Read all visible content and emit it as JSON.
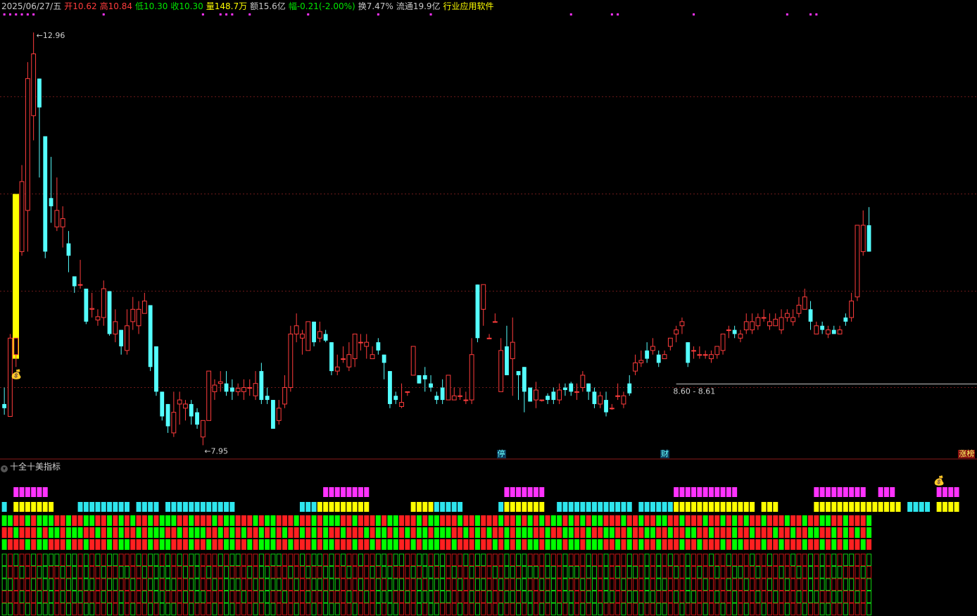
{
  "info": {
    "date": "2025/06/27/五",
    "open_label": "开",
    "open": "10.62",
    "high_label": "高",
    "high": "10.84",
    "low_label": "低",
    "low": "10.30",
    "close_label": "收",
    "close": "10.30",
    "volume": "量148.7万",
    "amount": "额15.6亿",
    "change": "幅-0.21(-2.00%)",
    "turnover": "换7.47%",
    "float_cap": "流通19.9亿",
    "industry": "行业应用软件"
  },
  "colors": {
    "up": "#ff3c3c",
    "down": "#54ffff",
    "grid": "#6e1a1a",
    "magenta": "#ff32ff",
    "yellow": "#ffff00",
    "green": "#00ff00",
    "red": "#ff2020",
    "cyan": "#2ee6ee"
  },
  "chart_data": {
    "type": "candlestick",
    "ylim": [
      7.8,
      13.2
    ],
    "high_label": "12.96",
    "low_label": "7.95",
    "range_label": "8.60 - 8.61",
    "range_level": 8.6,
    "grid_levels": [
      8.65,
      9.82,
      11.0,
      12.18
    ],
    "candles": [
      [
        8.45,
        8.4,
        8.65,
        8.32
      ],
      [
        8.3,
        9.25,
        9.3,
        8.3
      ],
      [
        9.05,
        9.25,
        9.25,
        8.9
      ],
      [
        10.3,
        11.15,
        11.35,
        10.25
      ],
      [
        10.8,
        12.4,
        12.6,
        10.3
      ],
      [
        11.95,
        12.7,
        12.96,
        11.65
      ],
      [
        12.4,
        12.05,
        12.4,
        11.2
      ],
      [
        11.7,
        10.3,
        11.7,
        10.22
      ],
      [
        10.95,
        10.85,
        11.45,
        10.65
      ],
      [
        10.6,
        10.8,
        11.2,
        10.55
      ],
      [
        10.6,
        10.7,
        10.85,
        10.35
      ],
      [
        10.4,
        10.25,
        10.55,
        10.05
      ],
      [
        10.0,
        9.88,
        10.0,
        9.8
      ],
      [
        9.9,
        9.9,
        10.2,
        9.85
      ],
      [
        9.85,
        9.45,
        9.85,
        9.42
      ],
      [
        9.6,
        9.61,
        9.8,
        9.5
      ],
      [
        9.47,
        9.51,
        9.6,
        9.4
      ],
      [
        9.5,
        9.85,
        9.95,
        9.4
      ],
      [
        9.82,
        9.3,
        9.82,
        9.28
      ],
      [
        9.3,
        9.45,
        9.6,
        9.2
      ],
      [
        9.35,
        9.15,
        9.35,
        9.05
      ],
      [
        9.1,
        9.4,
        9.6,
        9.05
      ],
      [
        9.45,
        9.6,
        9.75,
        9.35
      ],
      [
        9.4,
        9.6,
        9.7,
        9.3
      ],
      [
        9.55,
        9.7,
        9.8,
        9.55
      ],
      [
        9.65,
        8.9,
        9.65,
        8.85
      ],
      [
        9.15,
        8.6,
        9.15,
        8.55
      ],
      [
        8.6,
        8.3,
        8.6,
        8.25
      ],
      [
        8.45,
        8.18,
        8.45,
        8.1
      ],
      [
        8.1,
        8.35,
        8.6,
        8.05
      ],
      [
        8.45,
        8.5,
        8.6,
        8.2
      ],
      [
        8.4,
        8.45,
        8.5,
        8.25
      ],
      [
        8.45,
        8.3,
        8.5,
        8.2
      ],
      [
        8.35,
        8.2,
        8.4,
        8.15
      ],
      [
        8.05,
        8.25,
        8.25,
        7.95
      ],
      [
        8.25,
        8.85,
        8.85,
        8.25
      ],
      [
        8.6,
        8.68,
        8.75,
        8.5
      ],
      [
        8.7,
        8.72,
        8.85,
        8.6
      ],
      [
        8.7,
        8.6,
        8.85,
        8.55
      ],
      [
        8.65,
        8.6,
        8.75,
        8.5
      ],
      [
        8.6,
        8.64,
        8.7,
        8.55
      ],
      [
        8.6,
        8.65,
        8.75,
        8.5
      ],
      [
        8.65,
        8.65,
        8.75,
        8.55
      ],
      [
        8.55,
        8.7,
        8.85,
        8.5
      ],
      [
        8.85,
        8.5,
        8.95,
        8.45
      ],
      [
        8.55,
        8.5,
        8.65,
        8.45
      ],
      [
        8.5,
        8.15,
        8.5,
        8.15
      ],
      [
        8.25,
        8.4,
        8.5,
        8.2
      ],
      [
        8.45,
        8.65,
        8.8,
        8.4
      ],
      [
        8.65,
        9.3,
        9.4,
        8.6
      ],
      [
        9.3,
        9.4,
        9.55,
        9.2
      ],
      [
        9.25,
        9.3,
        9.35,
        9.05
      ],
      [
        9.1,
        9.45,
        9.45,
        9.1
      ],
      [
        9.45,
        9.2,
        9.45,
        9.15
      ],
      [
        9.25,
        9.33,
        9.45,
        9.2
      ],
      [
        9.3,
        9.22,
        9.35,
        9.2
      ],
      [
        9.2,
        8.85,
        9.2,
        8.8
      ],
      [
        8.85,
        8.9,
        9.05,
        8.8
      ],
      [
        9.0,
        9.0,
        9.15,
        8.95
      ],
      [
        8.9,
        9.05,
        9.2,
        8.85
      ],
      [
        9.0,
        9.3,
        9.3,
        8.9
      ],
      [
        9.2,
        9.2,
        9.3,
        9.1
      ],
      [
        9.15,
        9.2,
        9.3,
        9.0
      ],
      [
        9.0,
        9.05,
        9.15,
        9.0
      ],
      [
        9.2,
        9.1,
        9.25,
        9.05
      ],
      [
        9.05,
        8.95,
        9.05,
        8.75
      ],
      [
        8.85,
        8.45,
        8.85,
        8.4
      ],
      [
        8.55,
        8.5,
        8.6,
        8.45
      ],
      [
        8.42,
        8.47,
        8.7,
        8.4
      ],
      [
        8.6,
        8.6,
        8.6,
        8.55
      ],
      [
        8.8,
        9.15,
        9.15,
        8.8
      ],
      [
        8.8,
        8.7,
        8.8,
        8.7
      ],
      [
        8.8,
        8.75,
        8.9,
        8.6
      ],
      [
        8.7,
        8.65,
        8.8,
        8.6
      ],
      [
        8.55,
        8.5,
        8.6,
        8.45
      ],
      [
        8.65,
        8.5,
        8.75,
        8.45
      ],
      [
        8.5,
        8.8,
        8.8,
        8.5
      ],
      [
        8.5,
        8.55,
        8.65,
        8.5
      ],
      [
        8.55,
        8.55,
        8.65,
        8.5
      ],
      [
        8.5,
        8.5,
        8.6,
        8.45
      ],
      [
        8.5,
        9.05,
        9.25,
        8.45
      ],
      [
        9.9,
        9.25,
        9.9,
        9.2
      ],
      [
        9.6,
        9.9,
        9.9,
        9.4
      ],
      [
        9.25,
        9.25,
        9.3,
        9.25
      ],
      [
        9.45,
        9.45,
        9.55,
        9.45
      ],
      [
        8.6,
        9.1,
        9.25,
        8.6
      ],
      [
        9.15,
        8.8,
        9.4,
        8.8
      ],
      [
        9.0,
        9.2,
        9.5,
        8.55
      ],
      [
        8.85,
        8.8,
        8.85,
        8.5
      ],
      [
        8.9,
        8.6,
        8.9,
        8.35
      ],
      [
        8.65,
        8.48,
        8.65,
        8.48
      ],
      [
        8.5,
        8.62,
        8.72,
        8.4
      ],
      [
        8.5,
        8.5,
        8.5,
        8.48
      ],
      [
        8.55,
        8.5,
        8.58,
        8.45
      ],
      [
        8.6,
        8.5,
        8.65,
        8.45
      ],
      [
        8.5,
        8.62,
        8.7,
        8.45
      ],
      [
        8.65,
        8.62,
        8.7,
        8.55
      ],
      [
        8.7,
        8.6,
        8.72,
        8.55
      ],
      [
        8.6,
        8.6,
        8.7,
        8.5
      ],
      [
        8.65,
        8.8,
        8.85,
        8.6
      ],
      [
        8.7,
        8.6,
        8.7,
        8.5
      ],
      [
        8.6,
        8.45,
        8.65,
        8.4
      ],
      [
        8.45,
        8.55,
        8.6,
        8.4
      ],
      [
        8.5,
        8.35,
        8.6,
        8.3
      ],
      [
        8.4,
        8.4,
        8.45,
        8.38
      ],
      [
        8.55,
        8.55,
        8.7,
        8.5
      ],
      [
        8.45,
        8.55,
        8.6,
        8.4
      ],
      [
        8.7,
        8.58,
        8.8,
        8.55
      ],
      [
        8.85,
        8.95,
        9.05,
        8.8
      ],
      [
        8.95,
        8.98,
        9.1,
        8.9
      ],
      [
        9.1,
        9.0,
        9.2,
        8.95
      ],
      [
        9.1,
        9.15,
        9.25,
        9.05
      ],
      [
        9.05,
        8.95,
        9.1,
        8.9
      ],
      [
        9.0,
        9.05,
        9.1,
        9.0
      ],
      [
        9.15,
        9.25,
        9.25,
        9.1
      ],
      [
        9.3,
        9.35,
        9.4,
        9.2
      ],
      [
        9.4,
        9.45,
        9.5,
        9.3
      ],
      [
        9.2,
        8.95,
        9.2,
        8.9
      ],
      [
        9.1,
        9.1,
        9.15,
        9.0
      ],
      [
        9.05,
        9.05,
        9.15,
        9.0
      ],
      [
        9.05,
        9.05,
        9.1,
        9.0
      ],
      [
        9.0,
        9.05,
        9.1,
        8.95
      ],
      [
        9.05,
        9.15,
        9.15,
        9.0
      ],
      [
        9.1,
        9.3,
        9.3,
        9.05
      ],
      [
        9.35,
        9.35,
        9.4,
        9.25
      ],
      [
        9.35,
        9.3,
        9.4,
        9.25
      ],
      [
        9.25,
        9.3,
        9.35,
        9.2
      ],
      [
        9.35,
        9.45,
        9.55,
        9.3
      ],
      [
        9.35,
        9.45,
        9.55,
        9.3
      ],
      [
        9.4,
        9.5,
        9.55,
        9.35
      ],
      [
        9.5,
        9.5,
        9.6,
        9.45
      ],
      [
        9.4,
        9.45,
        9.55,
        9.35
      ],
      [
        9.4,
        9.48,
        9.55,
        9.4
      ],
      [
        9.35,
        9.5,
        9.6,
        9.3
      ],
      [
        9.5,
        9.55,
        9.6,
        9.45
      ],
      [
        9.45,
        9.5,
        9.6,
        9.4
      ],
      [
        9.55,
        9.65,
        9.75,
        9.5
      ],
      [
        9.6,
        9.75,
        9.85,
        9.6
      ],
      [
        9.6,
        9.45,
        9.7,
        9.35
      ],
      [
        9.3,
        9.4,
        9.45,
        9.3
      ],
      [
        9.4,
        9.35,
        9.45,
        9.3
      ],
      [
        9.3,
        9.35,
        9.4,
        9.25
      ],
      [
        9.35,
        9.3,
        9.4,
        9.3
      ],
      [
        9.3,
        9.35,
        9.4,
        9.3
      ],
      [
        9.5,
        9.45,
        9.55,
        9.4
      ],
      [
        9.5,
        9.7,
        9.8,
        9.45
      ],
      [
        9.75,
        10.62,
        10.62,
        9.7
      ],
      [
        10.3,
        10.62,
        10.8,
        10.25
      ],
      [
        10.62,
        10.3,
        10.84,
        10.3
      ]
    ],
    "markers": [
      {
        "text": "停",
        "candle": 85
      },
      {
        "text": "财",
        "candle": 113
      },
      {
        "text": "涨榜",
        "candle": 164
      }
    ]
  },
  "indicator": {
    "title": "十全十美指标"
  }
}
